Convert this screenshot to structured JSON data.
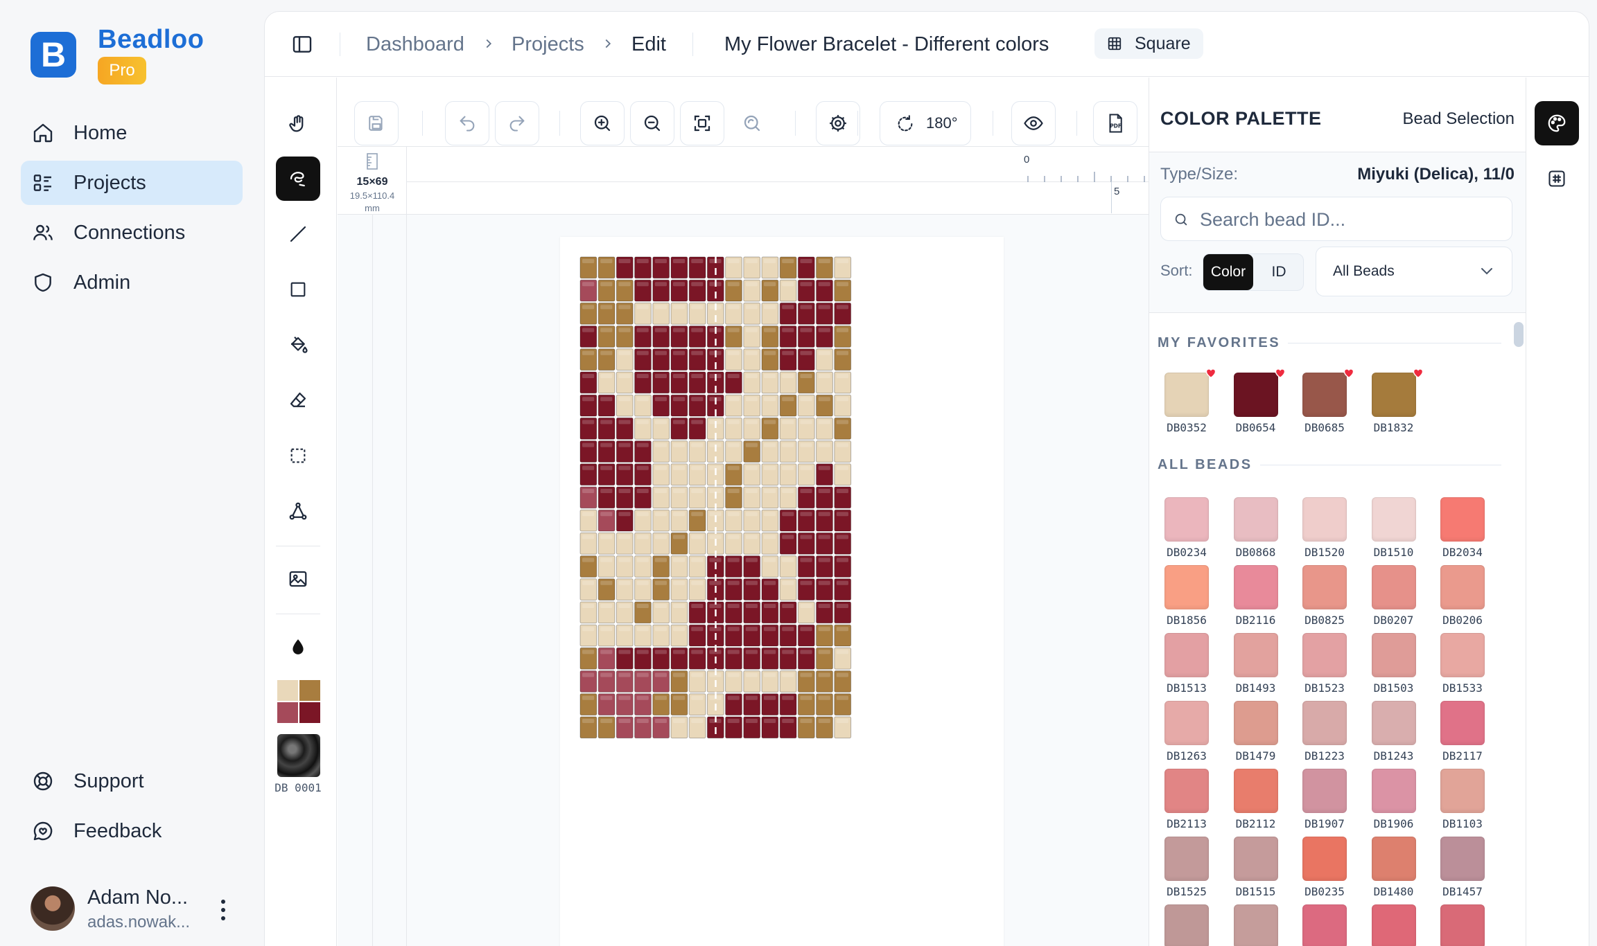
{
  "brand": {
    "name": "Beadloo",
    "plan": "Pro",
    "logo_letter": "B",
    "accent": "#1d6ed6"
  },
  "nav": [
    {
      "label": "Home",
      "icon": "home-icon",
      "active": false
    },
    {
      "label": "Projects",
      "icon": "projects-icon",
      "active": true
    },
    {
      "label": "Connections",
      "icon": "users-icon",
      "active": false
    },
    {
      "label": "Admin",
      "icon": "shield-icon",
      "active": false
    }
  ],
  "footer_nav": [
    {
      "label": "Support",
      "icon": "lifebuoy-icon"
    },
    {
      "label": "Feedback",
      "icon": "chat-icon"
    }
  ],
  "user": {
    "name": "Adam No...",
    "email": "adas.nowak..."
  },
  "breadcrumb": [
    "Dashboard",
    "Projects",
    "Edit"
  ],
  "project": {
    "title": "My Flower Bracelet - Different colors",
    "stitch": "Square"
  },
  "toolbar": {
    "rotation": "180°"
  },
  "canvas": {
    "size": "15×69",
    "size_mm": "19.5×110.4",
    "size_unit": "mm",
    "ruler_top": [
      "0",
      "5"
    ],
    "current_bead": "DB 0001"
  },
  "palette": {
    "title": "COLOR PALETTE",
    "subtitle": "Bead Selection",
    "type_label": "Type/Size:",
    "type_value": "Miyuki (Delica), 11/0",
    "search_placeholder": "Search bead ID...",
    "sort_label": "Sort:",
    "sort_options": [
      "Color",
      "ID"
    ],
    "filter": "All Beads",
    "favorites_label": "MY FAVORITES",
    "all_label": "ALL BEADS",
    "favorites": [
      {
        "id": "DB0352",
        "color": "#e5d3b6"
      },
      {
        "id": "DB0654",
        "color": "#6b1422"
      },
      {
        "id": "DB0685",
        "color": "#98574a"
      },
      {
        "id": "DB1832",
        "color": "#a57b3c"
      }
    ],
    "beads": [
      {
        "id": "DB0234",
        "color": "#ebb6bd"
      },
      {
        "id": "DB0868",
        "color": "#e8bdc2"
      },
      {
        "id": "DB1520",
        "color": "#efcdcb"
      },
      {
        "id": "DB1510",
        "color": "#f0d5d3"
      },
      {
        "id": "DB2034",
        "color": "#f67a72"
      },
      {
        "id": "DB1856",
        "color": "#f99f84"
      },
      {
        "id": "DB2116",
        "color": "#e88a9a"
      },
      {
        "id": "DB0825",
        "color": "#e8968a"
      },
      {
        "id": "DB0207",
        "color": "#e6918a"
      },
      {
        "id": "DB0206",
        "color": "#ea9a8d"
      },
      {
        "id": "DB1513",
        "color": "#e3a0a3"
      },
      {
        "id": "DB1493",
        "color": "#e2a29e"
      },
      {
        "id": "DB1523",
        "color": "#e3a1a3"
      },
      {
        "id": "DB1503",
        "color": "#df9c98"
      },
      {
        "id": "DB1533",
        "color": "#e8a8a2"
      },
      {
        "id": "DB1263",
        "color": "#e6aaa8"
      },
      {
        "id": "DB1479",
        "color": "#dd9c8f"
      },
      {
        "id": "DB1223",
        "color": "#d8aaa9"
      },
      {
        "id": "DB1243",
        "color": "#d9aeae"
      },
      {
        "id": "DB2117",
        "color": "#e07288"
      },
      {
        "id": "DB2113",
        "color": "#e18585"
      },
      {
        "id": "DB2112",
        "color": "#e87d6c"
      },
      {
        "id": "DB1907",
        "color": "#d193a0"
      },
      {
        "id": "DB1906",
        "color": "#db93a5"
      },
      {
        "id": "DB1103",
        "color": "#e1a498"
      },
      {
        "id": "DB1525",
        "color": "#c39a9a"
      },
      {
        "id": "DB1515",
        "color": "#c59b9b"
      },
      {
        "id": "DB0235",
        "color": "#e97562"
      },
      {
        "id": "DB1480",
        "color": "#dd806e"
      },
      {
        "id": "DB1457",
        "color": "#bb8f99"
      },
      {
        "id": "",
        "color": "#bf9897"
      },
      {
        "id": "",
        "color": "#c59d9b"
      },
      {
        "id": "",
        "color": "#dc6a80"
      },
      {
        "id": "",
        "color": "#df6877"
      },
      {
        "id": "",
        "color": "#d96a77"
      }
    ]
  },
  "pattern": {
    "columns": 15,
    "legend": {
      "C": "#e9d8ba",
      "G": "#a87d3f",
      "R": "#7b1626",
      "P": "#a54a5a"
    },
    "rows": [
      "GGRRRRRRCCCGRGC",
      "PGGRRRRRGCGCRRG",
      "GGGCCCCCCCCRRRR",
      "RGGRRRRRGCGRRRG",
      "GGCRRRRRCCGRRCG",
      "RCCRRRRRRCCCGCC",
      "RRCCRRRRCCCGCGC",
      "RRRCCRRCCCGCCCG",
      "RRRRCCCCCGCCCCC",
      "RRRRCCCCGCCCCRC",
      "PRRRCCCCGCCCRRR",
      "CPRCCCGCCCCRRRR",
      "CCCCCGCCCCCRRRR",
      "GCCCGCCRRRCCRRR",
      "CGCCGCCRRRRCRRR",
      "CCCGCCRRRRRRCRR",
      "CCCCCCRRRRRRRGG",
      "GPRRRRRRRRRRRGC",
      "PPPPPGCCCCCCGGG",
      "GPPPGGCCRRRRGGG",
      "GGPPPCCRRRRRGGC"
    ]
  }
}
